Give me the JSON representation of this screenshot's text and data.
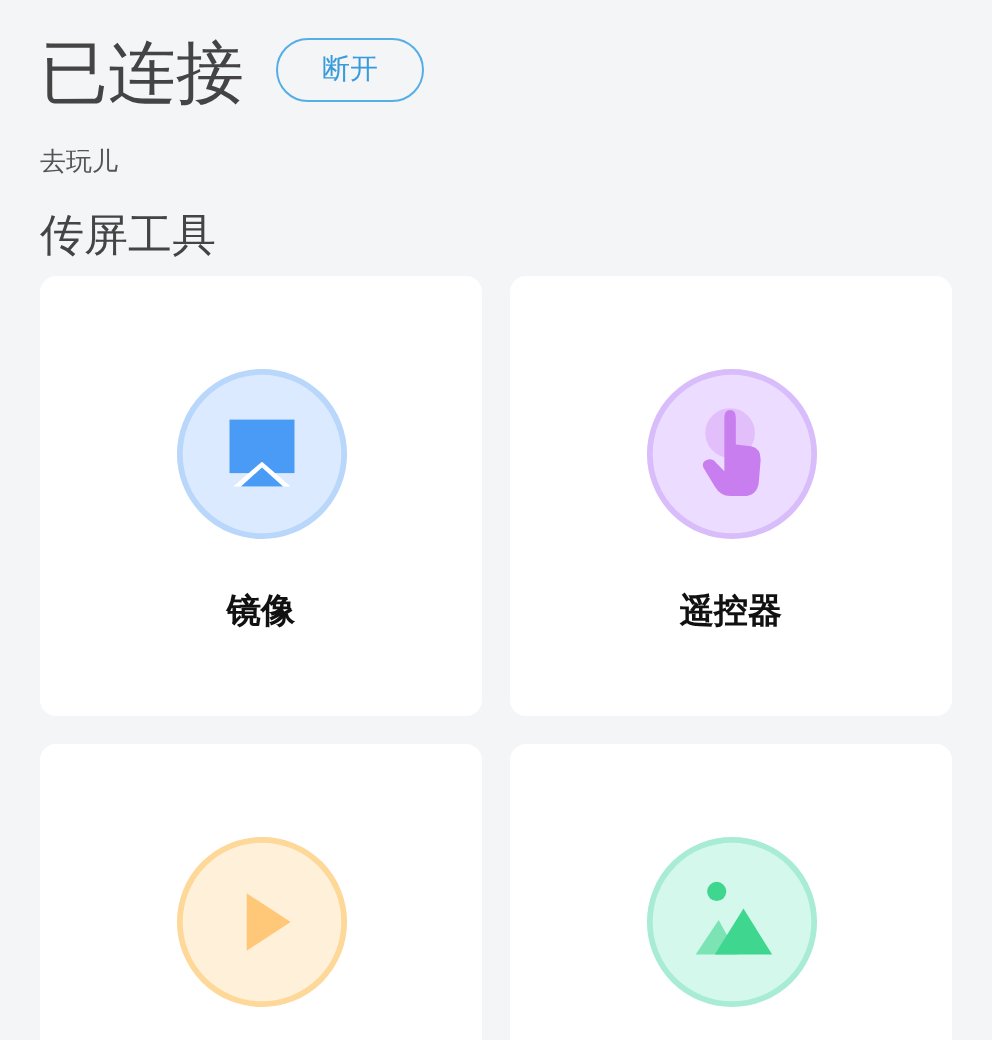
{
  "header": {
    "title": "已连接",
    "button": "断开"
  },
  "subtitle": "去玩儿",
  "section_title": "传屏工具",
  "tools": [
    {
      "kind": "mirror",
      "label": "镜像",
      "color": "#4a9bf5"
    },
    {
      "kind": "remote",
      "label": "遥控器",
      "color": "#c97ef0"
    },
    {
      "kind": "play",
      "color": "#ffc878"
    },
    {
      "kind": "image",
      "color": "#3fd68f"
    }
  ]
}
